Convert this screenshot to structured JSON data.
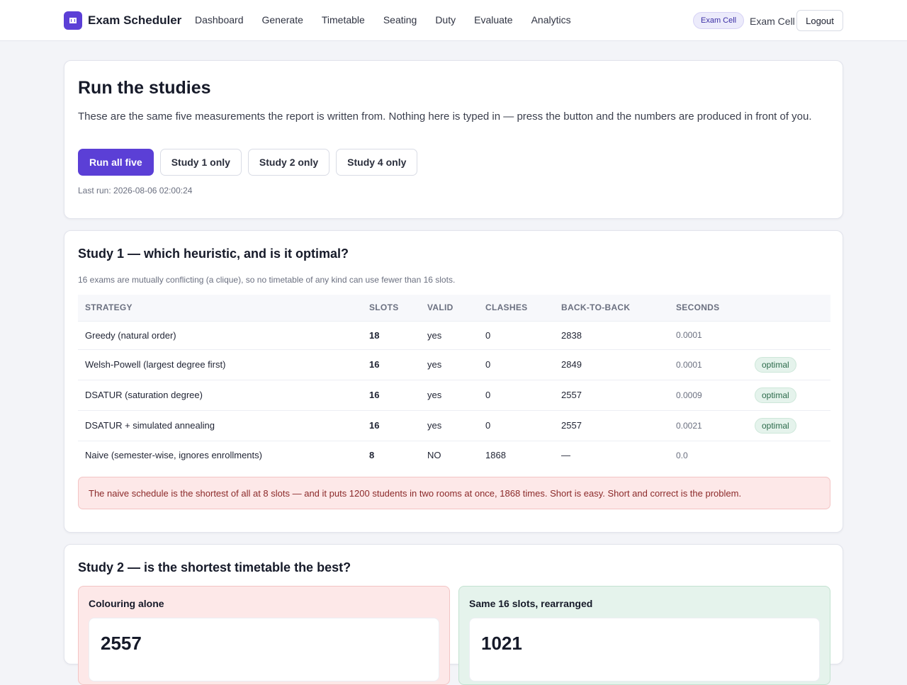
{
  "app": {
    "name": "Exam Scheduler"
  },
  "nav": [
    "Dashboard",
    "Generate",
    "Timetable",
    "Seating",
    "Duty",
    "Evaluate",
    "Analytics"
  ],
  "user": {
    "role_badge": "Exam Cell",
    "role_text": "Exam Cell",
    "logout": "Logout"
  },
  "intro": {
    "title": "Run the studies",
    "lead": "These are the same five measurements the report is written from. Nothing here is typed in — press the button and the numbers are produced in front of you.",
    "buttons": [
      "Run all five",
      "Study 1 only",
      "Study 2 only",
      "Study 4 only"
    ],
    "last_run": "Last run: 2026-08-06 02:00:24"
  },
  "study1": {
    "title": "Study 1 — which heuristic, and is it optimal?",
    "note": "16 exams are mutually conflicting (a clique), so no timetable of any kind can use fewer than 16 slots.",
    "headers": [
      "STRATEGY",
      "SLOTS",
      "VALID",
      "CLASHES",
      "BACK-TO-BACK",
      "SECONDS",
      ""
    ],
    "rows": [
      {
        "strategy": "Greedy (natural order)",
        "slots": "18",
        "valid": "yes",
        "clashes": "0",
        "b2b": "2838",
        "seconds": "0.0001",
        "badge": ""
      },
      {
        "strategy": "Welsh-Powell (largest degree first)",
        "slots": "16",
        "valid": "yes",
        "clashes": "0",
        "b2b": "2849",
        "seconds": "0.0001",
        "badge": "optimal"
      },
      {
        "strategy": "DSATUR (saturation degree)",
        "slots": "16",
        "valid": "yes",
        "clashes": "0",
        "b2b": "2557",
        "seconds": "0.0009",
        "badge": "optimal"
      },
      {
        "strategy": "DSATUR + simulated annealing",
        "slots": "16",
        "valid": "yes",
        "clashes": "0",
        "b2b": "2557",
        "seconds": "0.0021",
        "badge": "optimal"
      },
      {
        "strategy": "Naive (semester-wise, ignores enrollments)",
        "slots": "8",
        "valid": "NO",
        "clashes": "1868",
        "b2b": "—",
        "seconds": "0.0",
        "badge": ""
      }
    ],
    "alert": "The naive schedule is the shortest of all at 8 slots — and it puts 1200 students in two rooms at once, 1868 times. Short is easy. Short and correct is the problem."
  },
  "study2": {
    "title": "Study 2 — is the shortest timetable the best?",
    "left": {
      "title": "Colouring alone",
      "value": "2557"
    },
    "right": {
      "title": "Same 16 slots, rearranged",
      "value": "1021"
    }
  }
}
